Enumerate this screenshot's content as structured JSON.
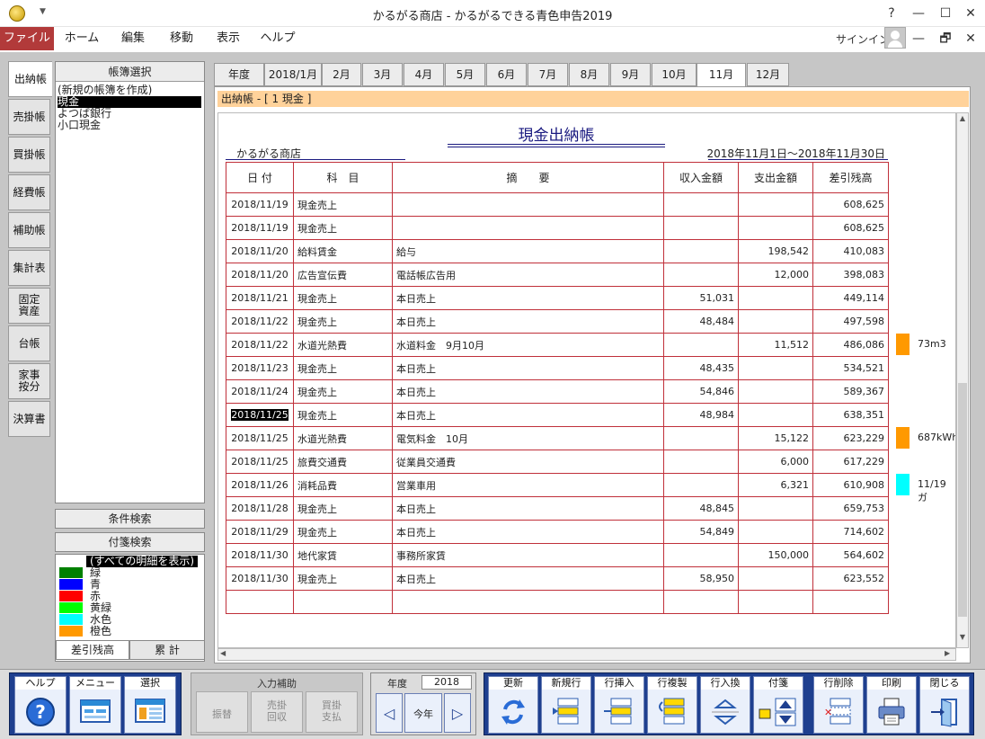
{
  "window": {
    "title": "かるがる商店 - かるがるできる青色申告2019",
    "controls": {
      "help": "?",
      "minimize": "—",
      "maximize": "☐",
      "close": "✕",
      "restore": "🗗"
    }
  },
  "menu": {
    "items": [
      "ファイル",
      "ホーム",
      "編集",
      "移動",
      "表示",
      "ヘルプ"
    ],
    "signin": "サインイン"
  },
  "side_tabs": [
    "出納帳",
    "売掛帳",
    "買掛帳",
    "経費帳",
    "補助帳",
    "集計表",
    "固定\n資産",
    "台帳",
    "家事\n按分",
    "決算書"
  ],
  "ledger_select": {
    "header": "帳簿選択",
    "items": [
      "(新規の帳簿を作成)",
      "現金",
      "よつば銀行",
      "小口現金"
    ]
  },
  "search": {
    "condition": "条件検索",
    "tag": "付箋検索"
  },
  "tags": {
    "all": "(すべての明細を表示)",
    "items": [
      {
        "label": "緑",
        "color": "#008000"
      },
      {
        "label": "青",
        "color": "#0000ff"
      },
      {
        "label": "赤",
        "color": "#ff0000"
      },
      {
        "label": "黄緑",
        "color": "#00ff00"
      },
      {
        "label": "水色",
        "color": "#00ffff"
      },
      {
        "label": "橙色",
        "color": "#ff9900"
      }
    ]
  },
  "bottom_tabs": {
    "balance": "差引残高",
    "cumulative": "累 計"
  },
  "month_tabs": [
    "年度",
    "2018/1月",
    "2月",
    "3月",
    "4月",
    "5月",
    "6月",
    "7月",
    "8月",
    "9月",
    "10月",
    "11月",
    "12月"
  ],
  "breadcrumb": "出納帳 - [ 1 現金 ]",
  "doc": {
    "title": "現金出納帳",
    "shop": "かるがる商店",
    "period": "2018年11月1日〜2018年11月30日",
    "columns": [
      "日 付",
      "科　目",
      "摘　　要",
      "収入金額",
      "支出金額",
      "差引残高"
    ],
    "rows": [
      {
        "date": "2018/11/19",
        "account": "現金売上",
        "memo": "",
        "income": "",
        "expense": "",
        "balance": "608,625"
      },
      {
        "date": "2018/11/19",
        "account": "現金売上",
        "memo": "",
        "income": "",
        "expense": "",
        "balance": "608,625"
      },
      {
        "date": "2018/11/20",
        "account": "給料賃金",
        "memo": "給与",
        "income": "",
        "expense": "198,542",
        "balance": "410,083"
      },
      {
        "date": "2018/11/20",
        "account": "広告宣伝費",
        "memo": "電話帳広告用",
        "income": "",
        "expense": "12,000",
        "balance": "398,083"
      },
      {
        "date": "2018/11/21",
        "account": "現金売上",
        "memo": "本日売上",
        "income": "51,031",
        "expense": "",
        "balance": "449,114"
      },
      {
        "date": "2018/11/22",
        "account": "現金売上",
        "memo": "本日売上",
        "income": "48,484",
        "expense": "",
        "balance": "497,598"
      },
      {
        "date": "2018/11/22",
        "account": "水道光熱費",
        "memo": "水道料金　9月10月",
        "income": "",
        "expense": "11,512",
        "balance": "486,086",
        "tag": {
          "color": "#ff9900",
          "text": "73m3"
        }
      },
      {
        "date": "2018/11/23",
        "account": "現金売上",
        "memo": "本日売上",
        "income": "48,435",
        "expense": "",
        "balance": "534,521"
      },
      {
        "date": "2018/11/24",
        "account": "現金売上",
        "memo": "本日売上",
        "income": "54,846",
        "expense": "",
        "balance": "589,367"
      },
      {
        "date": "2018/11/25",
        "account": "現金売上",
        "memo": "本日売上",
        "income": "48,984",
        "expense": "",
        "balance": "638,351",
        "selected": true
      },
      {
        "date": "2018/11/25",
        "account": "水道光熱費",
        "memo": "電気料金　10月",
        "income": "",
        "expense": "15,122",
        "balance": "623,229",
        "tag": {
          "color": "#ff9900",
          "text": "687kWh"
        }
      },
      {
        "date": "2018/11/25",
        "account": "旅費交通費",
        "memo": "従業員交通費",
        "income": "",
        "expense": "6,000",
        "balance": "617,229"
      },
      {
        "date": "2018/11/26",
        "account": "消耗品費",
        "memo": "営業車用",
        "income": "",
        "expense": "6,321",
        "balance": "610,908",
        "tag": {
          "color": "#00ffff",
          "text": "11/19 ガ"
        }
      },
      {
        "date": "2018/11/28",
        "account": "現金売上",
        "memo": "本日売上",
        "income": "48,845",
        "expense": "",
        "balance": "659,753"
      },
      {
        "date": "2018/11/29",
        "account": "現金売上",
        "memo": "本日売上",
        "income": "54,849",
        "expense": "",
        "balance": "714,602"
      },
      {
        "date": "2018/11/30",
        "account": "地代家賃",
        "memo": "事務所家賃",
        "income": "",
        "expense": "150,000",
        "balance": "564,602"
      },
      {
        "date": "2018/11/30",
        "account": "現金売上",
        "memo": "本日売上",
        "income": "58,950",
        "expense": "",
        "balance": "623,552"
      },
      {
        "date": "",
        "account": "",
        "memo": "",
        "income": "",
        "expense": "",
        "balance": ""
      }
    ]
  },
  "toolbar": {
    "help": "ヘルプ",
    "menu": "メニュー",
    "select": "選択",
    "input_assist": "入力補助",
    "transfer": "振替",
    "ar_collect": "売掛\n回収",
    "ap_pay": "買掛\n支払",
    "year_label": "年度",
    "year_value": "2018",
    "this_year": "今年",
    "update": "更新",
    "new_row": "新規行",
    "insert_row": "行挿入",
    "copy_row": "行複製",
    "swap_row": "行入換",
    "tag": "付箋",
    "delete_row": "行削除",
    "print": "印刷",
    "close": "閉じる"
  }
}
